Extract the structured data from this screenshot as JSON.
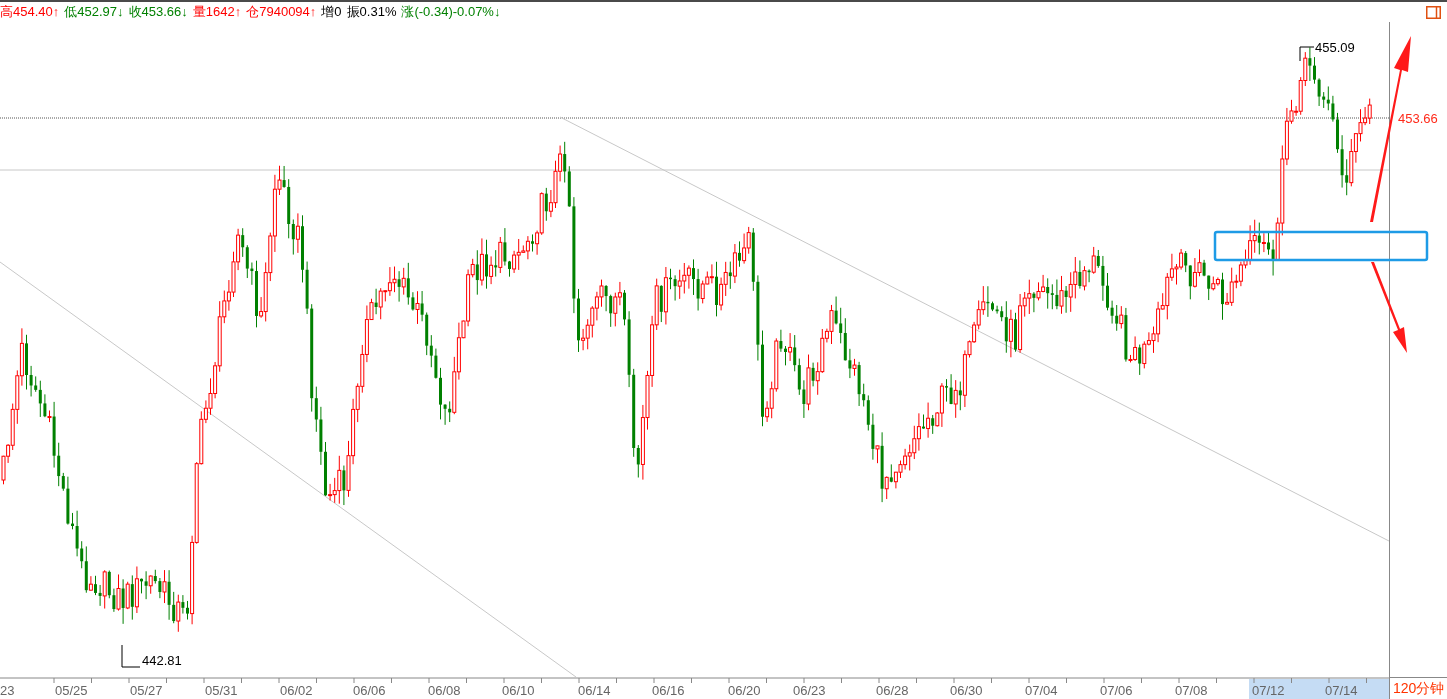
{
  "quote_bar": {
    "items": [
      {
        "label": "高",
        "value": "454.40",
        "arrow": "↑",
        "color": "#ff0000"
      },
      {
        "label": "低",
        "value": "452.97",
        "arrow": "↓",
        "color": "#008000"
      },
      {
        "label": "收",
        "value": "453.66",
        "arrow": "↓",
        "color": "#008000"
      },
      {
        "label": "量",
        "value": "1642",
        "arrow": "↑",
        "color": "#ff0000"
      },
      {
        "label": "仓",
        "value": "7940094",
        "arrow": "↑",
        "color": "#ff0000"
      },
      {
        "label": "增",
        "value": "0",
        "color": "#000000"
      },
      {
        "label": "振",
        "value": "0.31%",
        "color": "#000000"
      },
      {
        "label": "涨",
        "value": "(-0.34)-0.07%",
        "arrow": "↓",
        "color": "#008000"
      }
    ]
  },
  "chart": {
    "high_label": "455.09",
    "low_label": "442.81",
    "last_price": "453.66"
  },
  "date_axis": {
    "period": "120分钟",
    "dates": [
      {
        "label": "23",
        "highlighted": false
      },
      {
        "label": "05/25",
        "highlighted": false
      },
      {
        "label": "05/27",
        "highlighted": false
      },
      {
        "label": "05/31",
        "highlighted": false
      },
      {
        "label": "06/02",
        "highlighted": false
      },
      {
        "label": "06/06",
        "highlighted": false
      },
      {
        "label": "06/08",
        "highlighted": false
      },
      {
        "label": "06/10",
        "highlighted": false
      },
      {
        "label": "06/14",
        "highlighted": false
      },
      {
        "label": "06/16",
        "highlighted": false
      },
      {
        "label": "06/20",
        "highlighted": false
      },
      {
        "label": "06/23",
        "highlighted": false
      },
      {
        "label": "06/28",
        "highlighted": false
      },
      {
        "label": "06/30",
        "highlighted": false
      },
      {
        "label": "07/04",
        "highlighted": false
      },
      {
        "label": "07/06",
        "highlighted": false
      },
      {
        "label": "07/08",
        "highlighted": false
      },
      {
        "label": "07/12",
        "highlighted": true
      },
      {
        "label": "07/14",
        "highlighted": true
      }
    ]
  }
}
